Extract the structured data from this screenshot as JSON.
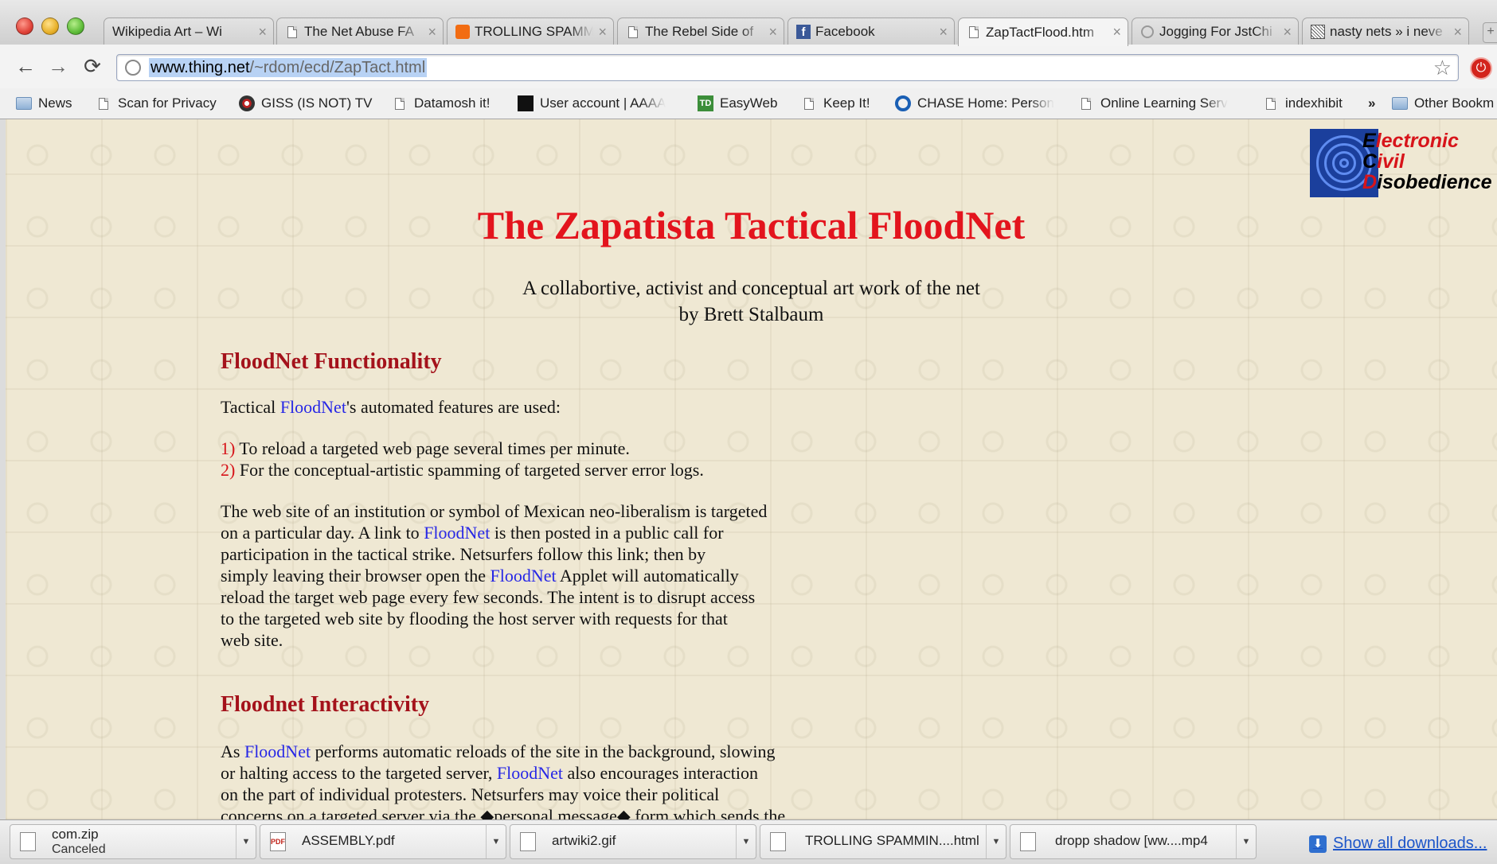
{
  "window": {
    "tabs": [
      {
        "title": "Wikipedia Art – Wi",
        "icon": "page-icon",
        "active": false
      },
      {
        "title": "The Net Abuse FA",
        "icon": "page-icon",
        "active": false
      },
      {
        "title": "TROLLING SPAMM",
        "icon": "orange-favicon",
        "active": false
      },
      {
        "title": "The Rebel Side of",
        "icon": "page-icon",
        "active": false
      },
      {
        "title": "Facebook",
        "icon": "facebook-icon",
        "active": false
      },
      {
        "title": "ZapTactFlood.htm",
        "icon": "page-icon",
        "active": true
      },
      {
        "title": "Jogging For JstChi",
        "icon": "globe-icon",
        "active": false
      },
      {
        "title": "nasty nets » i neve",
        "icon": "nasty-nets-icon",
        "active": false
      }
    ]
  },
  "toolbar": {
    "url_host": "www.thing.net",
    "url_path": "/~rdom/ecd/ZapTact.html"
  },
  "bookmarks": [
    {
      "label": "News",
      "icon": "folder-icon"
    },
    {
      "label": "Scan for Privacy",
      "icon": "page-icon"
    },
    {
      "label": "GISS (IS NOT) TV",
      "icon": "giss-icon"
    },
    {
      "label": "Datamosh it!",
      "icon": "page-icon"
    },
    {
      "label": "User account | AAAA",
      "icon": "black-square-icon"
    },
    {
      "label": "EasyWeb",
      "icon": "td-icon"
    },
    {
      "label": "Keep It!",
      "icon": "page-icon"
    },
    {
      "label": "CHASE Home: Person",
      "icon": "chase-icon"
    },
    {
      "label": "Online Learning Serv",
      "icon": "page-icon"
    },
    {
      "label": "indexhibit",
      "icon": "page-icon"
    },
    {
      "label": "»",
      "icon": "chevron-icon"
    },
    {
      "label": "Other Bookm",
      "icon": "folder-icon"
    }
  ],
  "page": {
    "logo": {
      "line1_initial": "E",
      "line1_rest": "lectronic",
      "line2_initial": "C",
      "line2_rest": "ivil",
      "line3_initial": "D",
      "line3_rest": "isobedience"
    },
    "title": "The Zapatista Tactical FloodNet",
    "subtitle_line1": "A collabortive, activist and conceptual art work of the net",
    "subtitle_line2": "by Brett Stalbaum",
    "section1": {
      "heading": "FloodNet Functionality",
      "intro_before": "Tactical ",
      "intro_link": "FloodNet",
      "intro_after": "'s automated features are used:",
      "item1_num": "1)",
      "item1_text": " To reload a targeted web page several times per minute.",
      "item2_num": "2)",
      "item2_text": " For the conceptual-artistic spamming of targeted server error logs.",
      "p_a": "The web site of an institution or symbol of Mexican neo-liberalism is targeted",
      "p_b1": "on a particular day. A link to ",
      "p_b_link": "FloodNet",
      "p_b2": " is then posted in a public call for",
      "p_c": "participation in the tactical strike. Netsurfers follow this link; then by",
      "p_d1": "simply leaving their browser open the ",
      "p_d_link": "FloodNet",
      "p_d2": " Applet will automatically",
      "p_e": "reload the target web page every few seconds. The intent is to disrupt access",
      "p_f": "to the targeted web site by flooding the host server with requests for that",
      "p_g": "web site."
    },
    "section2": {
      "heading": "Floodnet Interactivity",
      "p_a1": "As ",
      "p_a_link": "FloodNet",
      "p_a2": " performs automatic reloads of the site in the background, slowing",
      "p_b1": "or halting access to the targeted server, ",
      "p_b_link": "FloodNet",
      "p_b2": " also encourages interaction",
      "p_c": "on the part of individual protesters. Netsurfers may voice their political",
      "p_d": "concerns on a targeted server via the ◆personal message◆ form which sends the"
    }
  },
  "downloads": {
    "items": [
      {
        "name": "com.zip",
        "status": "Canceled",
        "icon": "zip-file-icon"
      },
      {
        "name": "ASSEMBLY.pdf",
        "status": "",
        "icon": "pdf-file-icon"
      },
      {
        "name": "artwiki2.gif",
        "status": "",
        "icon": "image-file-icon"
      },
      {
        "name": "TROLLING SPAMMIN....html",
        "status": "",
        "icon": "html-file-icon"
      },
      {
        "name": "dropp shadow [ww....mp4",
        "status": "",
        "icon": "page-icon"
      }
    ],
    "show_all_label": "Show all downloads..."
  }
}
